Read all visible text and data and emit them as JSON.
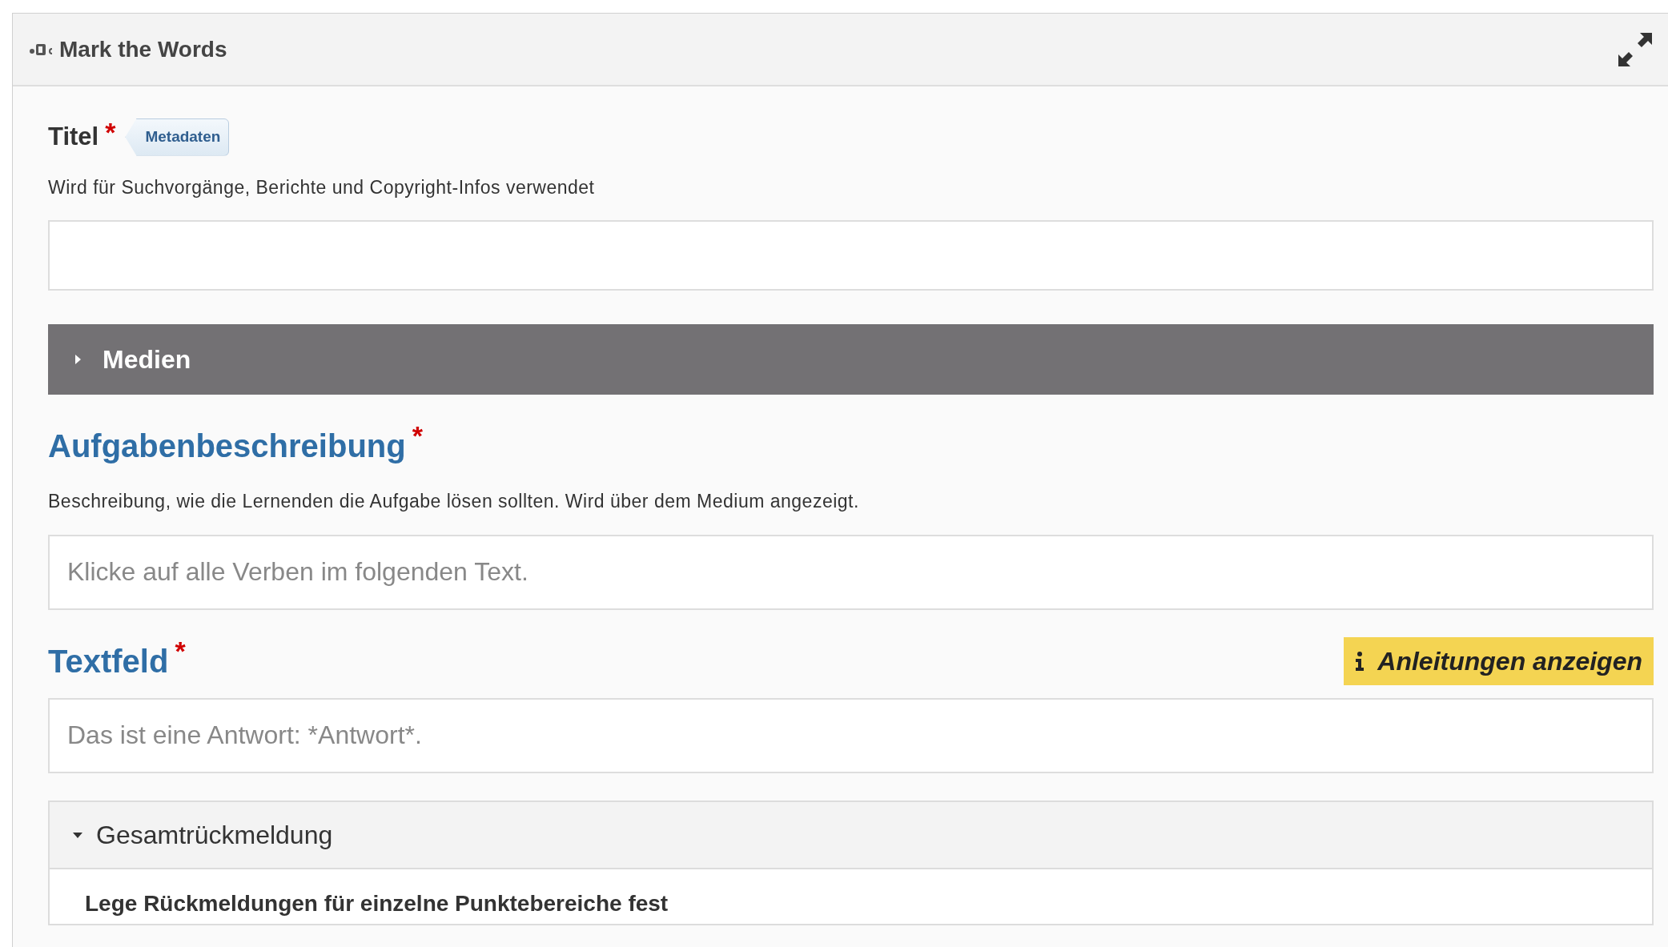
{
  "window": {
    "title": "Mark the Words"
  },
  "items": [
    {
      "kind": "field",
      "label": "Titel",
      "required_mark": "*",
      "tag": "Metadaten",
      "description": "Wird für Suchvorgänge, Berichte und Copyright-Infos verwendet"
    },
    {
      "kind": "collapsible",
      "label": "Medien",
      "expanded": false
    },
    {
      "kind": "field-large",
      "label": "Aufgabenbeschreibung",
      "required_mark": "*",
      "description": "Beschreibung, wie die Lernenden die Aufgabe lösen sollten. Wird über dem Medium angezeigt.",
      "placeholder": "Klicke auf alle Verben im folgenden Text."
    },
    {
      "kind": "field-large",
      "label": "Textfeld",
      "required_mark": "*",
      "button": "Anleitungen anzeigen",
      "placeholder": "Das ist eine Antwort: *Antwort*."
    },
    {
      "kind": "panel",
      "label": "Gesamtrückmeldung",
      "expanded": true,
      "content": "Lege Rückmeldungen für einzelne Punktebereiche fest"
    }
  ]
}
